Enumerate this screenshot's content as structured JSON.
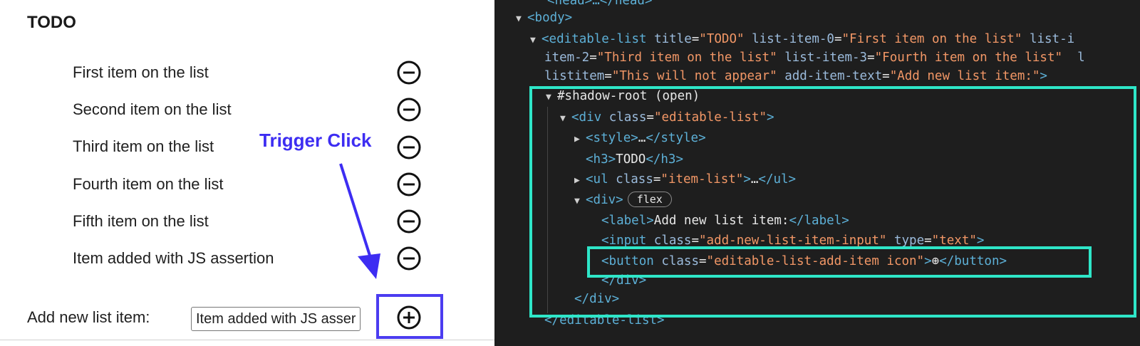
{
  "todo": {
    "title": "TODO",
    "items": [
      "First item on the list",
      "Second item on the list",
      "Third item on the list",
      "Fourth item on the list",
      "Fifth item on the list",
      "Item added with JS assertion"
    ],
    "add_label": "Add new list item:",
    "input_value": "Item added with JS assertion"
  },
  "annotation": {
    "text": "Trigger Click",
    "color": "#3d2df2"
  },
  "devtools": {
    "lines": {
      "head": "<head>…</head>",
      "body_open": "<body>",
      "el_open_1": "editable-list",
      "el_attr_title": "title",
      "el_val_title": "\"TODO\"",
      "el_attr_item0": "list-item-0",
      "el_val_item0": "\"First item on the list\"",
      "el_attr_item1": "list-i",
      "el_line2_attr": "item-2",
      "el_line2_val": "\"Third item on the list\"",
      "el_line2_attr2": "list-item-3",
      "el_line2_val2": "\"Fourth item on the list\"",
      "el_line2_tail": "l",
      "el_line3_attr": "listitem",
      "el_line3_val": "\"This will not appear\"",
      "el_line3_attr2": "add-item-text",
      "el_line3_val2": "\"Add new list item:\"",
      "shadow_root": "#shadow-root (open)",
      "div_tag": "div",
      "div_class_attr": "class",
      "div_class_val": "\"editable-list\"",
      "style_tag": "style",
      "h3_tag": "h3",
      "h3_text": "TODO",
      "ul_tag": "ul",
      "ul_class_val": "\"item-list\"",
      "div2_tag": "div",
      "flex_badge": "flex",
      "label_tag": "label",
      "label_text": "Add new list item:",
      "input_tag": "input",
      "input_class_val": "\"add-new-list-item-input\"",
      "input_type_attr": "type",
      "input_type_val": "\"text\"",
      "button_tag": "button",
      "button_class_val": "\"editable-list-add-item icon\"",
      "button_text": "⊕",
      "div_close": "</div>",
      "el_close": "</editable-list>"
    },
    "highlight_color": "#2ee6c8"
  }
}
